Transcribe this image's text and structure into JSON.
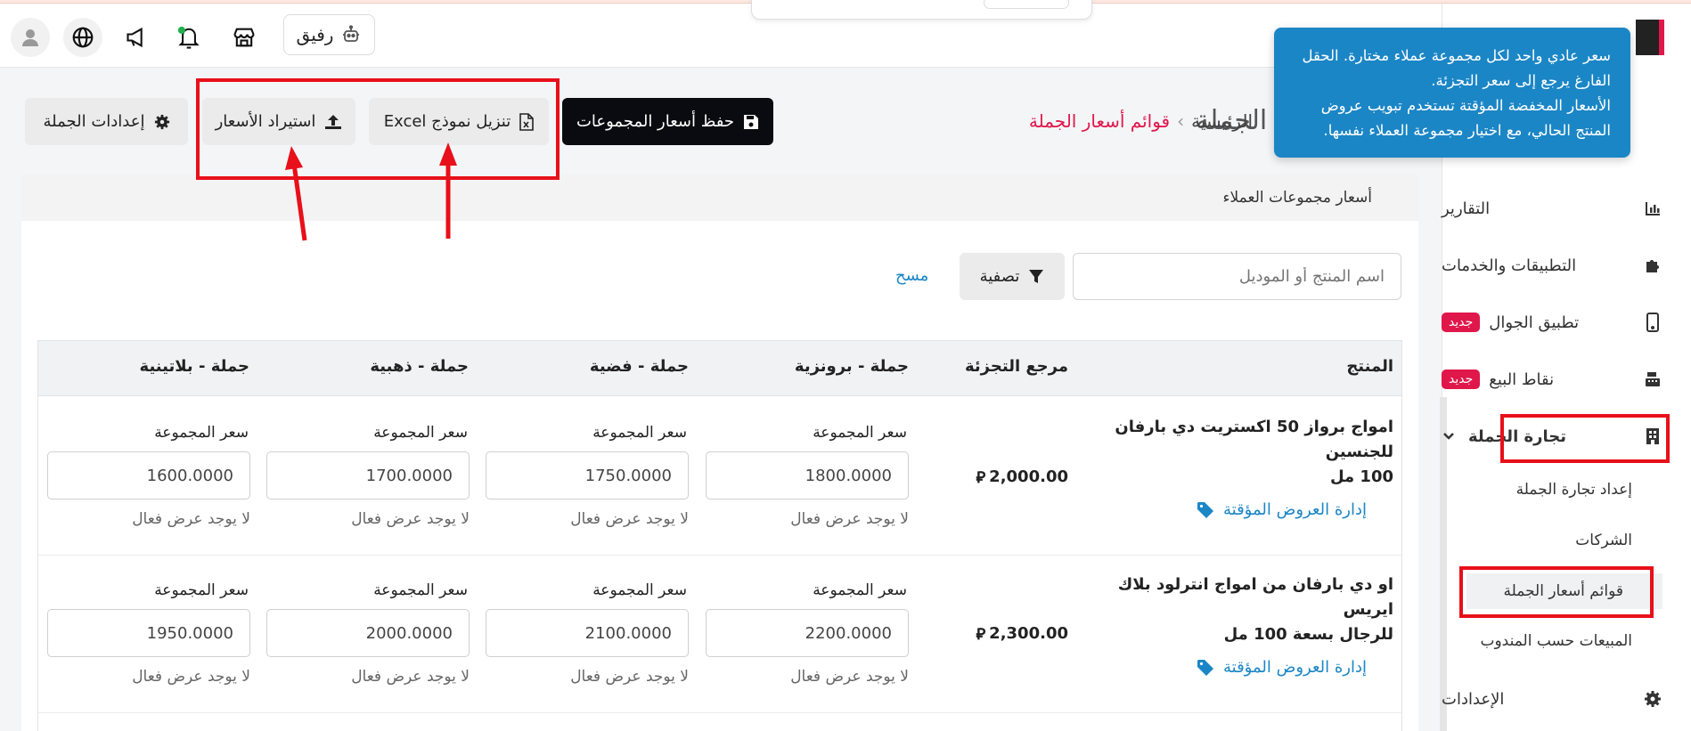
{
  "topbar": {
    "rafiq_label": "رفيق"
  },
  "tooltip": {
    "line1": "سعر عادي واحد لكل مجموعة عملاء مختارة. الحقل",
    "line2": "الفارغ يرجع إلى سعر التجزئة.",
    "line3": "الأسعار المخفضة المؤقتة تستخدم تبويب عروض",
    "line4": "المنتج الحالي، مع اختيار مجموعة العملاء نفسها."
  },
  "breadcrumb": {
    "title_fragment": "الجملة",
    "home": "الرئيسية",
    "separator": "›",
    "current": "قوائم أسعار الجملة"
  },
  "toolbar": {
    "save": "حفظ أسعار المجموعات",
    "download": "تنزيل نموذج Excel",
    "import": "استيراد الأسعار",
    "settings": "إعدادات الجملة"
  },
  "section": {
    "title": "أسعار مجموعات العملاء"
  },
  "filters": {
    "search_placeholder": "اسم المنتج أو الموديل",
    "filter_label": "تصفية",
    "clear_label": "مسح"
  },
  "table": {
    "headers": {
      "product": "المنتج",
      "retail": "مرجع التجزئة",
      "bronze": "جملة - برونزية",
      "silver": "جملة - فضية",
      "gold": "جملة - ذهبية",
      "platinum": "جملة - بلاتينية"
    },
    "group_price_label": "سعر المجموعة",
    "no_offer": "لا يوجد عرض فعال",
    "temp_offers_link": "إدارة العروض المؤقتة",
    "rows": [
      {
        "name_line1": "امواج برواز 50 اكستريت دي بارفان للجنسين",
        "name_line2": "100 مل",
        "retail": "2,000.00",
        "bronze": "1800.0000",
        "silver": "1750.0000",
        "gold": "1700.0000",
        "platinum": "1600.0000"
      },
      {
        "name_line1": "او دي بارفان من امواج انترلود بلاك ايريس",
        "name_line2": "للرجال بسعة 100 مل",
        "retail": "2,300.00",
        "bronze": "2200.0000",
        "silver": "2100.0000",
        "gold": "2000.0000",
        "platinum": "1950.0000"
      }
    ]
  },
  "sidebar": {
    "items": [
      {
        "label": "التقارير"
      },
      {
        "label": "التطبيقات والخدمات"
      },
      {
        "label": "تطبيق الجوال",
        "badge": "جديد"
      },
      {
        "label": "نقاط البيع",
        "badge": "جديد"
      },
      {
        "label": "تجارة الجملة"
      }
    ],
    "sub_items": [
      {
        "label": "إعداد تجارة الجملة"
      },
      {
        "label": "الشركات"
      },
      {
        "label": "قوائم أسعار الجملة"
      },
      {
        "label": "المبيعات حسب المندوب"
      }
    ],
    "settings": "الإعدادات"
  },
  "colors": {
    "accent": "#e0174a",
    "link": "#1b86c6",
    "tooltip_bg": "#1b86c6",
    "annotation_red": "#e8101a"
  }
}
